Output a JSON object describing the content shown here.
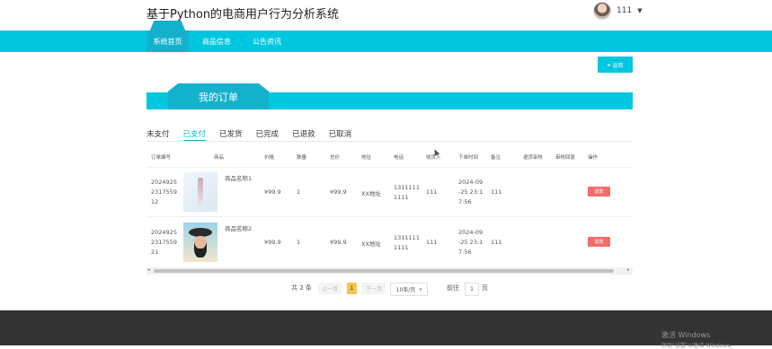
{
  "header": {
    "site_title": "基于Python的电商用户行为分析系统",
    "username": "111"
  },
  "nav": {
    "items": [
      {
        "label": "系统首页"
      },
      {
        "label": "商品信息"
      },
      {
        "label": "公告资讯"
      }
    ]
  },
  "page": {
    "back_label": "返回",
    "banner_title": "我的订单"
  },
  "tabs": [
    "未支付",
    "已支付",
    "已发货",
    "已完成",
    "已退款",
    "已取消"
  ],
  "table": {
    "headers": [
      "订单编号",
      "商品",
      "价格",
      "数量",
      "总价",
      "地址",
      "电话",
      "收货人",
      "下单时间",
      "备注",
      "退货审核",
      "审核回复",
      "操作"
    ],
    "rows": [
      {
        "order_no": "2024925 2317559 12",
        "product_name": "商品名称1",
        "price": "¥99.9",
        "qty": "1",
        "total": "¥99.9",
        "address": "XX地址",
        "phone": "1311111 1111",
        "receiver": "111",
        "time": "2024-09 -25 23:1 7:56",
        "remark": "111",
        "action": "退款"
      },
      {
        "order_no": "2024925 2317559 21",
        "product_name": "商品名称2",
        "price": "¥99.9",
        "qty": "1",
        "total": "¥99.9",
        "address": "XX地址",
        "phone": "1311111 1111",
        "receiver": "111",
        "time": "2024-09 -25 23:1 7:56",
        "remark": "111",
        "action": "退款"
      }
    ]
  },
  "pagination": {
    "total_text": "共 2 条",
    "prev": "上一页",
    "current": "1",
    "next": "下一页",
    "page_size": "10条/页",
    "goto_prefix": "前往",
    "goto_value": "1",
    "goto_suffix": "页"
  },
  "watermark": {
    "line1": "激活 Windows",
    "line2": "转到\"设置\"以激活 Windows。"
  },
  "colors": {
    "accent": "#00c7e0",
    "accent_dark": "#14b1cc",
    "danger": "#f56c6c",
    "footer": "#333333"
  }
}
